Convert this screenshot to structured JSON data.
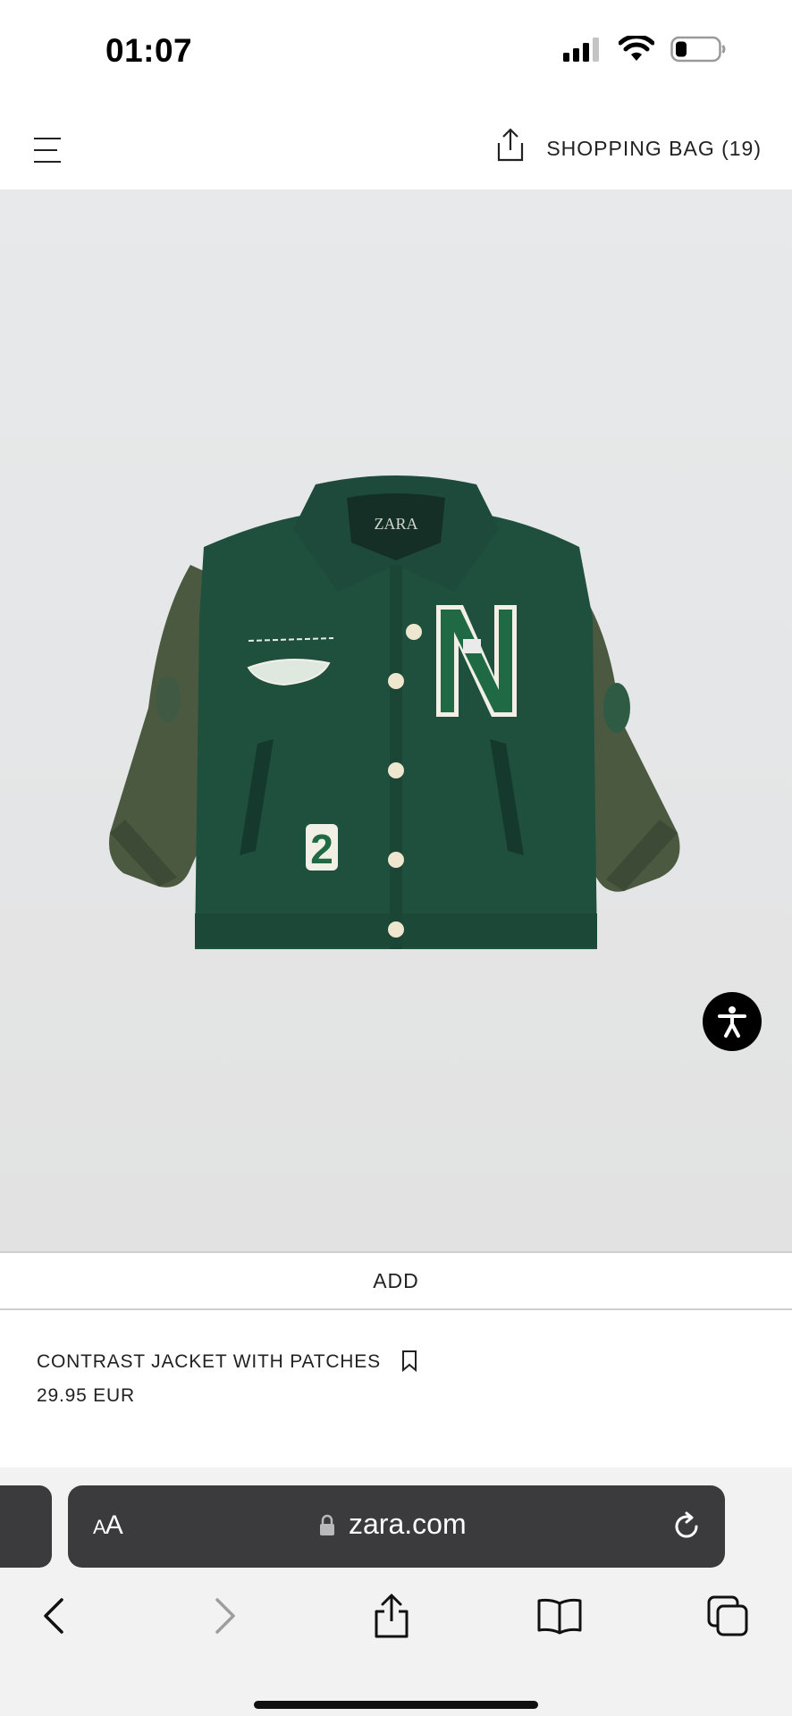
{
  "status_bar": {
    "time": "01:07",
    "icons": [
      "cellular-signal-icon",
      "wifi-icon",
      "battery-icon"
    ]
  },
  "header": {
    "menu_icon": "hamburger-menu-icon",
    "share_icon": "share-icon",
    "shopping_bag_label": "SHOPPING BAG (19)"
  },
  "product": {
    "image_description": "green wool varsity jacket with contrast sleeves and patches",
    "add_label": "ADD",
    "name": "CONTRAST JACKET WITH PATCHES",
    "price": "29.95 EUR",
    "bookmark_icon": "bookmark-icon",
    "accessibility_icon": "accessibility-icon"
  },
  "browser": {
    "aa_label_big": "A",
    "aa_label_small": "A",
    "url": "zara.com",
    "lock_icon": "lock-icon",
    "reload_icon": "reload-icon",
    "toolbar": [
      "back-icon",
      "forward-icon",
      "share-icon",
      "bookmarks-icon",
      "tabs-icon"
    ]
  },
  "colors": {
    "jacket_body": "#1f4f3d",
    "jacket_sleeve": "#48573f",
    "background": "#e6e7e8",
    "url_bar": "#3b3b3d"
  }
}
